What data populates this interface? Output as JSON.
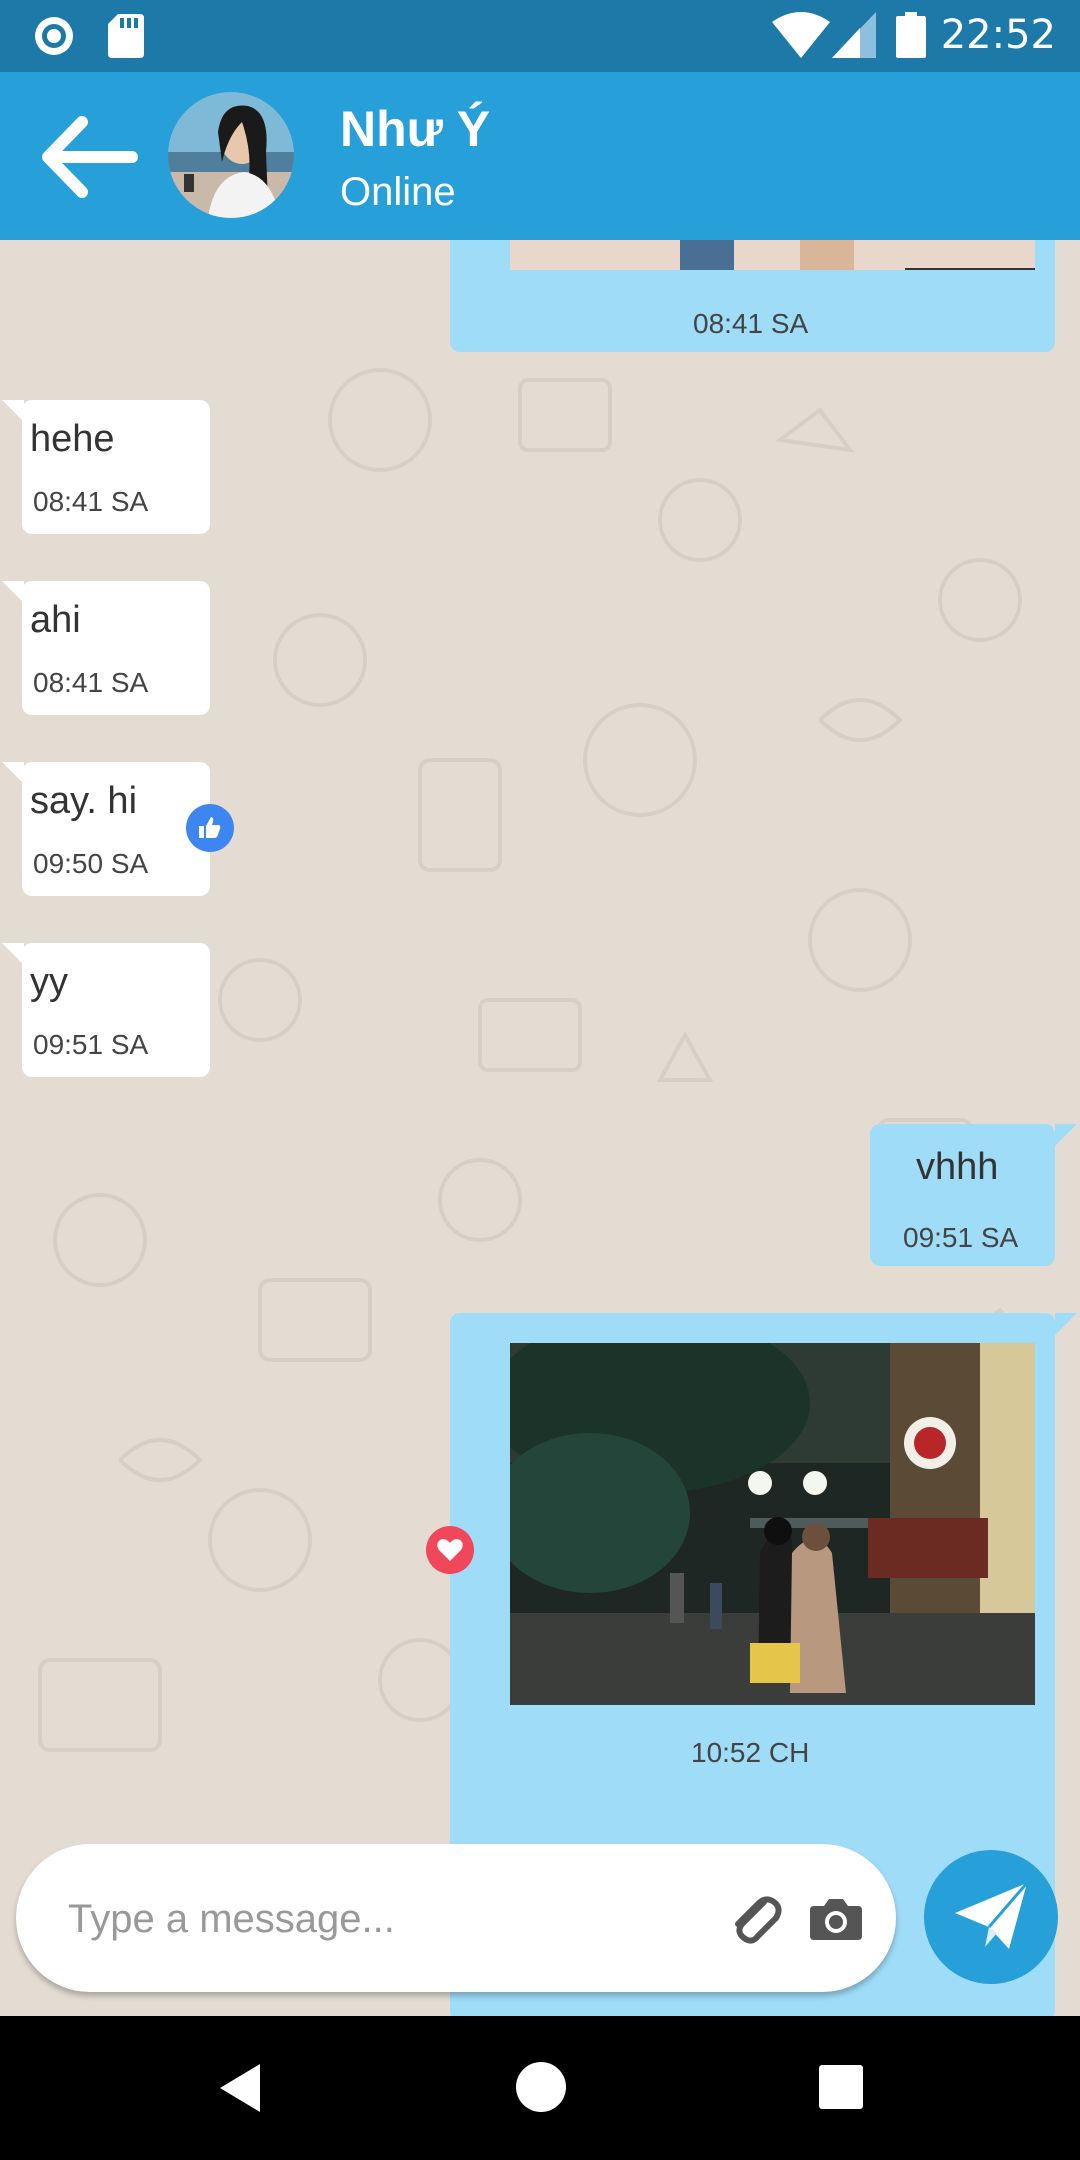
{
  "status_bar": {
    "time": "22:52",
    "icons": [
      "record-icon",
      "sd-card-icon",
      "wifi-icon",
      "signal-icon",
      "battery-icon"
    ]
  },
  "header": {
    "contact_name": "Như Ý",
    "contact_status": "Online",
    "icons": [
      "back-arrow-icon",
      "avatar"
    ]
  },
  "messages": [
    {
      "direction": "out",
      "type": "image",
      "time": "08:41 SA"
    },
    {
      "direction": "in",
      "type": "text",
      "text": "hehe",
      "time": "08:41 SA"
    },
    {
      "direction": "in",
      "type": "text",
      "text": "ahi",
      "time": "08:41 SA"
    },
    {
      "direction": "in",
      "type": "text",
      "text": "say. hi",
      "time": "09:50 SA",
      "reaction": "like-icon"
    },
    {
      "direction": "in",
      "type": "text",
      "text": "yy",
      "time": "09:51 SA"
    },
    {
      "direction": "out",
      "type": "text",
      "text": "vhhh",
      "time": "09:51 SA"
    },
    {
      "direction": "out",
      "type": "image",
      "time": "10:52 CH",
      "reaction": "heart-icon"
    }
  ],
  "composer": {
    "placeholder": "Type a message...",
    "icons": [
      "attach-icon",
      "camera-icon",
      "send-icon"
    ]
  },
  "nav": {
    "icons": [
      "nav-back-icon",
      "nav-home-icon",
      "nav-recents-icon"
    ]
  },
  "colors": {
    "status_bar": "#1d79a8",
    "app_bar": "#279fd8",
    "outgoing_bubble": "#9fdcf8",
    "incoming_bubble": "#ffffff",
    "chat_background": "#e4dcd2",
    "like_reaction": "#3d86f0",
    "heart_reaction": "#f0475b"
  }
}
